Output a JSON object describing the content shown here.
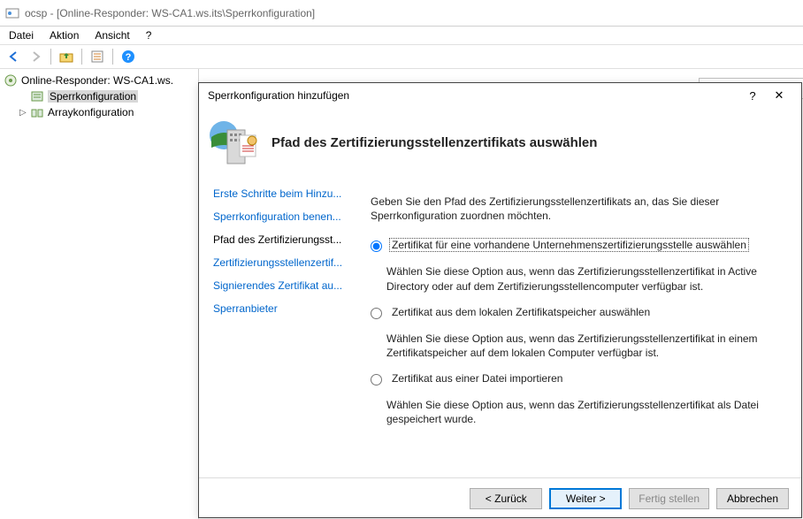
{
  "window": {
    "title": "ocsp - [Online-Responder: WS-CA1.ws.its\\Sperrkonfiguration]"
  },
  "menu": {
    "file": "Datei",
    "action": "Aktion",
    "view": "Ansicht",
    "help": "?"
  },
  "tree": {
    "root": "Online-Responder: WS-CA1.ws.",
    "node1": "Sperrkonfiguration",
    "node2": "Arraykonfiguration"
  },
  "wizard": {
    "title": "Sperrkonfiguration hinzufügen",
    "header_title": "Pfad des Zertifizierungsstellenzertifikats auswählen",
    "nav": {
      "step1": "Erste Schritte beim Hinzu...",
      "step2": "Sperrkonfiguration benen...",
      "step3": "Pfad des Zertifizierungsst...",
      "step4": "Zertifizierungsstellenzertif...",
      "step5": "Signierendes Zertifikat au...",
      "step6": "Sperranbieter"
    },
    "intro": "Geben Sie den Pfad des Zertifizierungsstellenzertifikats an, das Sie dieser Sperrkonfiguration zuordnen möchten.",
    "opt1": {
      "label": "Zertifikat für eine vorhandene Unternehmenszertifizierungsstelle auswählen",
      "desc": "Wählen Sie diese Option aus, wenn das Zertifizierungsstellenzertifikat in Active Directory oder auf dem Zertifizierungsstellencomputer verfügbar ist."
    },
    "opt2": {
      "label": "Zertifikat aus dem lokalen Zertifikatspeicher auswählen",
      "desc": "Wählen Sie diese Option aus, wenn das Zertifizierungsstellenzertifikat in einem Zertifikatspeicher auf dem lokalen Computer verfügbar ist."
    },
    "opt3": {
      "label": "Zertifikat aus einer Datei importieren",
      "desc": "Wählen Sie diese Option aus, wenn das Zertifizierungsstellenzertifikat als Datei gespeichert wurde."
    },
    "buttons": {
      "back": "<  Zurück",
      "next": "Weiter  >",
      "finish": "Fertig stellen",
      "cancel": "Abbrechen"
    }
  }
}
